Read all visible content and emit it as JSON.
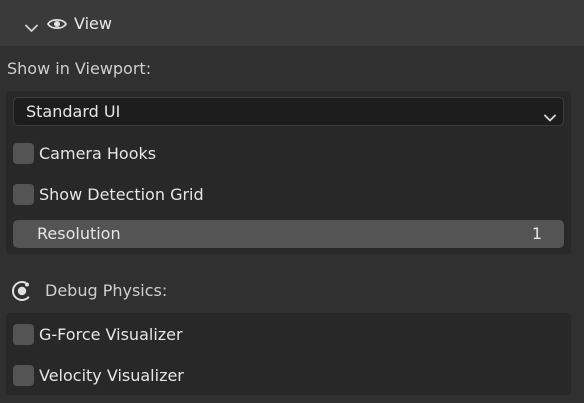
{
  "header": {
    "title": "View",
    "chevron_icon": "chevron-down-icon",
    "eye_icon": "eye-icon"
  },
  "viewport": {
    "label": "Show in Viewport:",
    "dropdown": {
      "selected": "Standard UI"
    },
    "camera_hooks": {
      "label": "Camera Hooks",
      "checked": false
    },
    "detection_grid": {
      "label": "Show Detection Grid",
      "checked": false
    },
    "resolution": {
      "label": "Resolution",
      "value": "1"
    }
  },
  "physics": {
    "label": "Debug Physics:",
    "icon": "physics-toggle-icon",
    "gforce": {
      "label": "G-Force Visualizer",
      "checked": false
    },
    "velocity": {
      "label": "Velocity Visualizer",
      "checked": false
    }
  },
  "colors": {
    "panel_bg": "#303030",
    "header_bg": "#3a3a3a",
    "box_bg": "#282828",
    "checkbox": "#545454",
    "text": "#e6e6e6"
  }
}
